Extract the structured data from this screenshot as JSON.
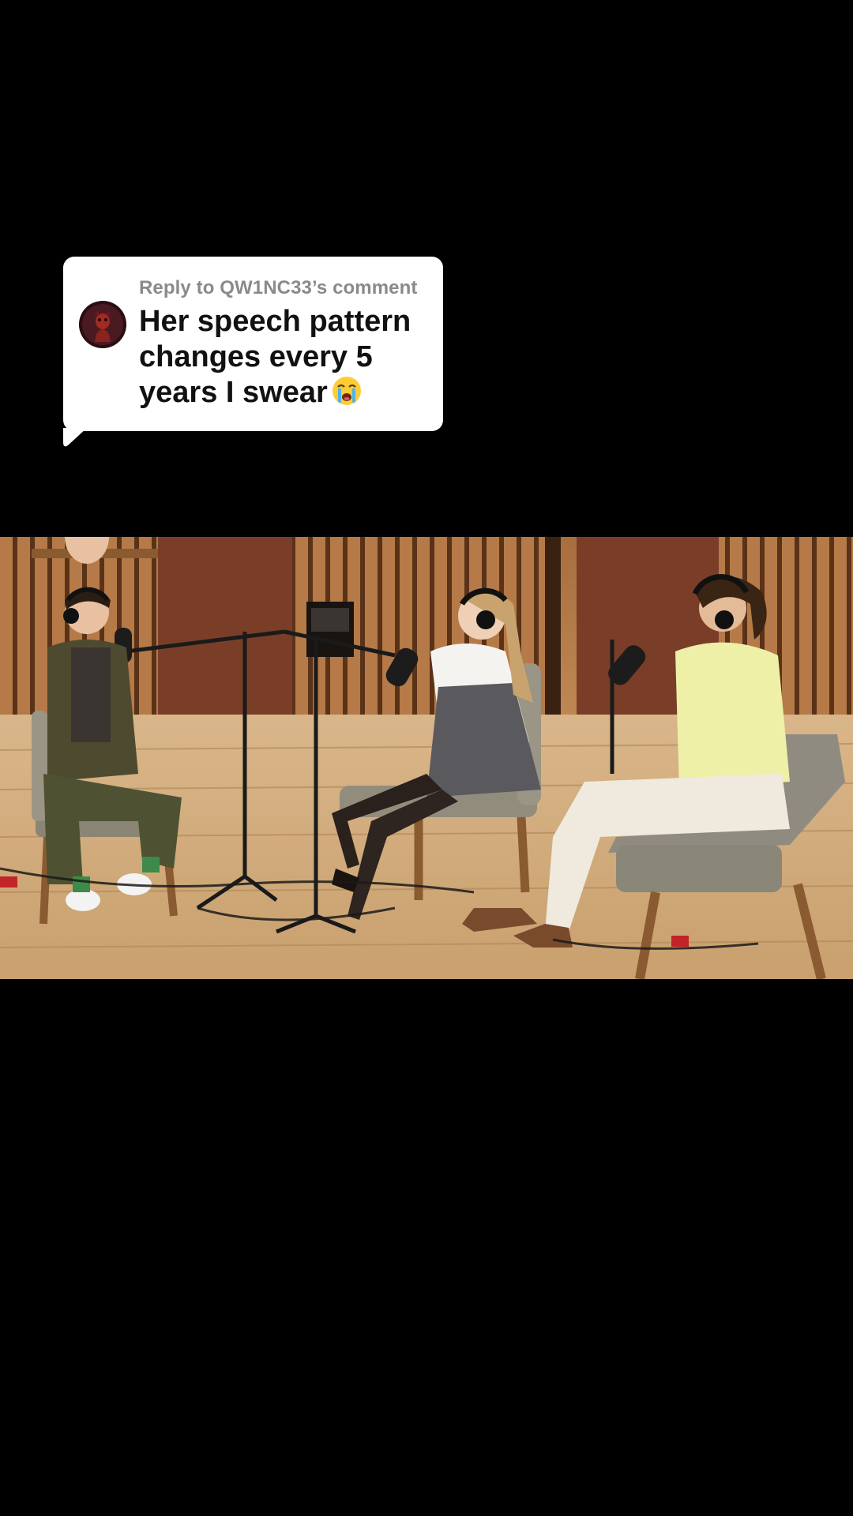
{
  "reply_sticker": {
    "label": "Reply to QW1NC33’s comment",
    "comment": "Her speech pattern changes every 5 years I swear",
    "emoji_icon": "loudly-crying-face-icon"
  },
  "video": {
    "scene": "three-people-seated-podcast-studio"
  },
  "colors": {
    "background": "#000000",
    "bubble": "#ffffff",
    "label_gray": "#8a8a8a",
    "comment_text": "#111111"
  }
}
